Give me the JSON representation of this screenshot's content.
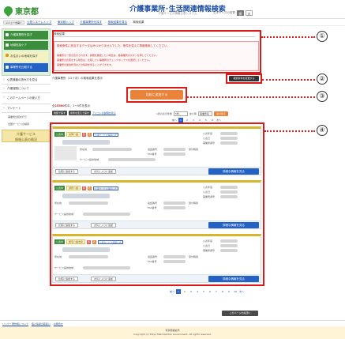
{
  "header": {
    "logo_text": "東京都",
    "title": "介護事業所･生活関連情報検索",
    "subtitle": "介護サービス情報公表システム",
    "fontsize_label": "文字サイズの変更",
    "size_buttons": [
      "標準",
      "大"
    ]
  },
  "breadcrumb": {
    "menu_label": "メニューを開く",
    "items": [
      "公表システムトップ",
      "東京都トップ",
      "介護事業所を探す",
      "検索結果を見る",
      "検索結果"
    ]
  },
  "sidebar": {
    "green_items": [
      "介護事業所を探す",
      "地域包括ケア",
      "お住まいの地域を探す",
      "事業所を比較する"
    ],
    "links": [
      "公表情報の読み方を見る",
      "介護保険について",
      "このホームページの使い方",
      "アンケート"
    ],
    "sub_items": [
      "事業所比較を行う",
      "全国サービスの検索"
    ],
    "banner": [
      "介護サービス",
      "情報公表の概況"
    ]
  },
  "main": {
    "heading": "検索結果",
    "notice_title": "検索条件に該当するデータはみつかりませんでした。条件を変えて再度検索してください。",
    "notice_lines": [
      "事業所の一覧が表示されます。詳細を確認したい場合は、各事業所のボタンを押してください。",
      "事業所の比較をする場合は、比較したい事業所のチェックボックスを選択してください。",
      "事業所の運営状況などの情報を見ることができます。"
    ],
    "search_condition": "介護事業所（12ヶ月）の検索結果を表示",
    "condition_button": "検索条件を変更する",
    "action_button": "比較に追加する",
    "result_count_prefix": "全",
    "result_count_value": "15500",
    "result_count_suffix": "件中、1～5件を表示",
    "sort_buttons": [
      "地図で探す",
      "条件を変えて探す"
    ],
    "sort_link": "アイコンの説明を見る",
    "view_label": "1頁の表示件数",
    "view_select": "5件",
    "sort_label": "並び順",
    "sort_select": "事業所名",
    "sort_go": "並び替え",
    "pages": [
      "1",
      "2",
      "3",
      "4",
      "5",
      "6",
      "7",
      "8",
      "9",
      "10"
    ],
    "current_page": "1",
    "prev_label": "前へ",
    "next_label": "次へ"
  },
  "cards": [
    {
      "status": "公表中",
      "category": "訪問介護",
      "badges": [
        "新",
        "表"
      ],
      "outline_tag": "介護サービス情報公表",
      "fields": [
        "所在地",
        "電話番号",
        "FAX番号",
        "受付時間",
        "サービス提供地域"
      ],
      "right_fields": [
        "公表年度",
        "公表日",
        "事業所番号"
      ],
      "buttons": [
        "比較に追加する",
        "お気に入りに追加"
      ],
      "detail": "詳細な情報を見る"
    },
    {
      "status": "公表中",
      "category": "通所介護",
      "badges": [
        "新",
        "表"
      ],
      "outline_tag": "介護サービス情報公表",
      "fields": [
        "所在地",
        "電話番号",
        "FAX番号",
        "受付時間",
        "サービス提供地域"
      ],
      "right_fields": [
        "公表年度",
        "公表日",
        "事業所番号"
      ],
      "buttons": [
        "比較に追加する",
        "お気に入りに追加"
      ],
      "detail": "詳細な情報を見る"
    },
    {
      "status": "公表中",
      "category": "居宅介護支援",
      "badges": [
        "新",
        "表"
      ],
      "outline_tag": "介護サービス情報公表",
      "fields": [
        "所在地",
        "電話番号",
        "FAX番号",
        "受付時間",
        "サービス提供地域"
      ],
      "right_fields": [
        "公表年度",
        "公表日",
        "事業所番号"
      ],
      "buttons": [
        "比較に追加する",
        "お気に入りに追加"
      ],
      "detail": "詳細な情報を見る"
    }
  ],
  "callouts": [
    "①",
    "②",
    "③",
    "④"
  ],
  "footer": {
    "back_top": "このページの先頭へ",
    "links": [
      "リンク・著作権について",
      "個人情報の取扱い",
      "お問合せ"
    ],
    "org": "東京都福祉局",
    "copyright": "Copyright (c) Tokyo Metropolitan Government. All rights reserved."
  },
  "colors": {
    "brand_green": "#3b8e3b",
    "accent_blue": "#2562c6",
    "highlight_red": "#e01818",
    "action_orange": "#e9833a",
    "card_gold": "#d9b52c"
  }
}
